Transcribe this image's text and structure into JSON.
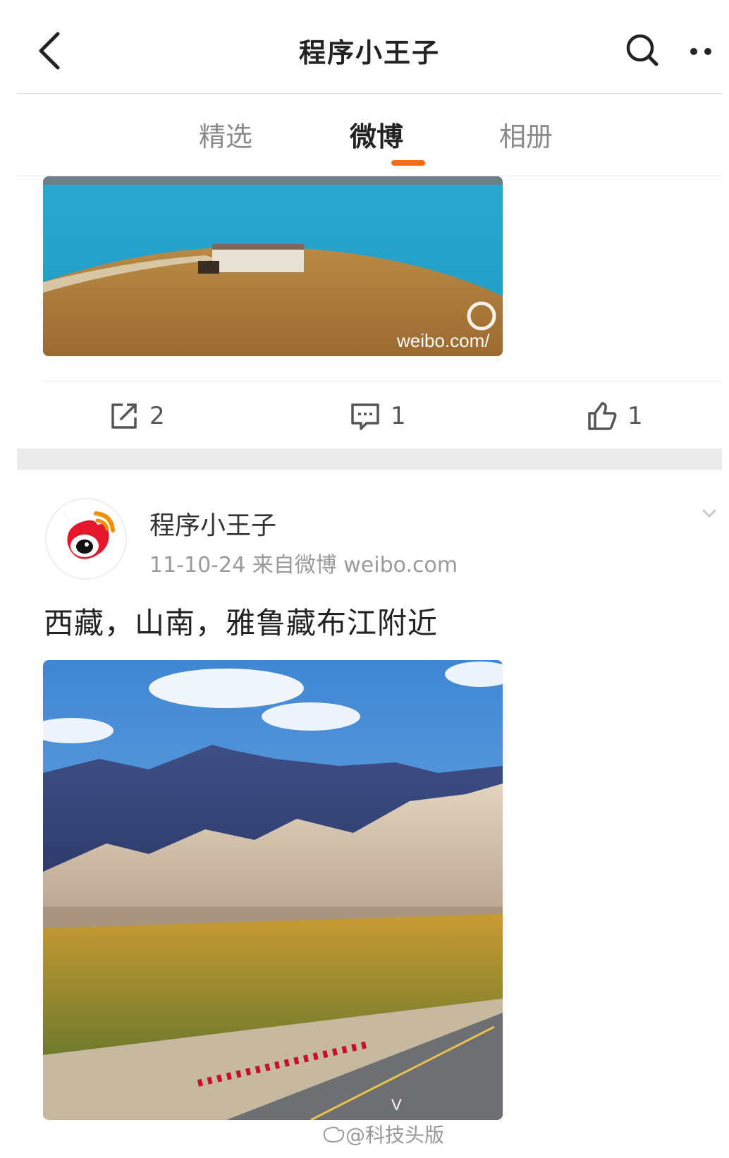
{
  "header": {
    "title": "程序小王子",
    "back_icon": "chevron-left-icon",
    "search_icon": "search-icon",
    "more_icon": "more-dots-icon"
  },
  "tabs": [
    {
      "label": "精选",
      "active": false
    },
    {
      "label": "微博",
      "active": true
    },
    {
      "label": "相册",
      "active": false
    }
  ],
  "accent_color": "#ff6a13",
  "first_post": {
    "image_watermark": "weibo.com/",
    "actions": {
      "repost_count": "2",
      "comment_count": "1",
      "like_count": "1"
    }
  },
  "second_post": {
    "author": "程序小王子",
    "meta": "11-10-24  来自微博 weibo.com",
    "text": "西藏，山南，雅鲁藏布江附近",
    "image_watermark": "V"
  },
  "page_watermark": "@科技头版"
}
